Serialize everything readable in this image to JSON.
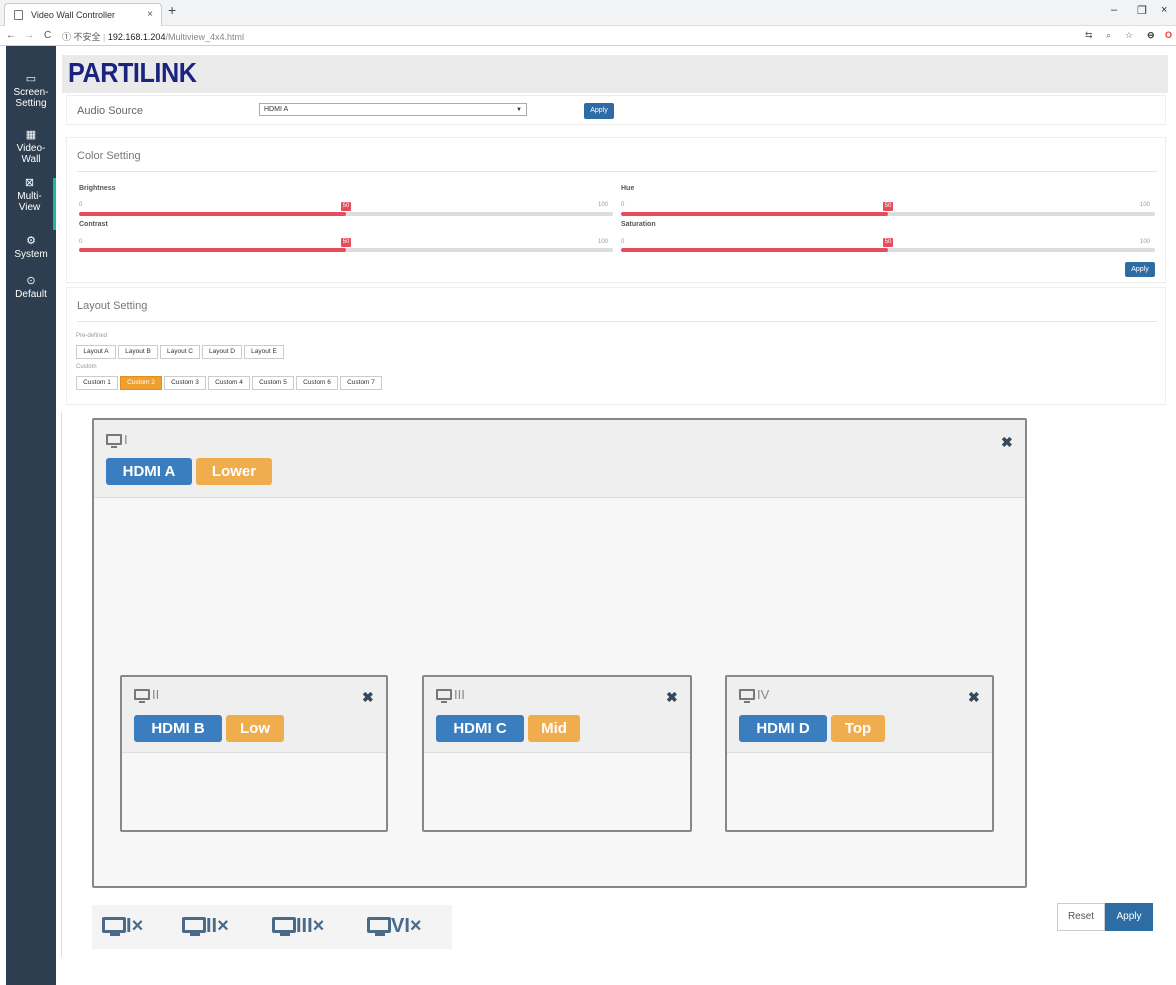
{
  "browser": {
    "tab_title": "Video Wall Controller",
    "tab_close": "×",
    "new_tab": "+",
    "nav_back": "←",
    "nav_forward": "→",
    "reload": "C",
    "security_text": "① 不安全",
    "separator": "|",
    "url_host": "192.168.1.204",
    "url_path": "/Multiview_4x4.html",
    "win_minimize": "–",
    "win_restore": "❐",
    "win_close": "×"
  },
  "sidebar": {
    "items": [
      {
        "icon": "monitor-icon",
        "glyph": "▭",
        "label1": "Screen-",
        "label2": "Setting"
      },
      {
        "icon": "grid-icon",
        "glyph": "▦",
        "label1": "Video-",
        "label2": "Wall"
      },
      {
        "icon": "multiview-icon",
        "glyph": "⊠",
        "label1": "Multi-",
        "label2": "View"
      },
      {
        "icon": "gear-icon",
        "glyph": "⚙",
        "label1": "System",
        "label2": ""
      },
      {
        "icon": "reset-icon",
        "glyph": "⊙",
        "label1": "Default",
        "label2": ""
      }
    ]
  },
  "header": {
    "logo": "PARTILINK"
  },
  "audio": {
    "label": "Audio Source",
    "selected": "HDMI A",
    "apply_label": "Apply"
  },
  "color": {
    "title": "Color Setting",
    "brightness": {
      "label": "Brightness",
      "min": "0",
      "max": "100",
      "value": "50"
    },
    "contrast": {
      "label": "Contrast",
      "min": "0",
      "max": "100",
      "value": "50"
    },
    "hue": {
      "label": "Hue",
      "min": "0",
      "max": "100",
      "value": "50"
    },
    "saturation": {
      "label": "Saturation",
      "min": "0",
      "max": "100",
      "value": "50"
    },
    "apply_label": "Apply"
  },
  "layout": {
    "title": "Layout Setting",
    "predefined_label": "Pre-defined",
    "predefined": [
      "Layout A",
      "Layout B",
      "Layout C",
      "Layout D",
      "Layout E"
    ],
    "custom_label": "Custom",
    "custom": [
      "Custom 1",
      "Custom 2",
      "Custom 3",
      "Custom 4",
      "Custom 5",
      "Custom 6",
      "Custom 7"
    ],
    "active_custom": "Custom 2"
  },
  "windows": [
    {
      "name": "I",
      "source": "HDMI A",
      "layer": "Lower"
    },
    {
      "name": "II",
      "source": "HDMI B",
      "layer": "Low"
    },
    {
      "name": "III",
      "source": "HDMI C",
      "layer": "Mid"
    },
    {
      "name": "IV",
      "source": "HDMI D",
      "layer": "Top"
    }
  ],
  "tray": {
    "items": [
      "I",
      "II",
      "III",
      "VI"
    ],
    "remove_glyph": "×"
  },
  "actions": {
    "reset_label": "Reset",
    "apply_label": "Apply"
  },
  "colors": {
    "sidebar": "#2c3e50",
    "primary": "#2e6da4",
    "accent": "#f0ad4e",
    "slider": "#e74c5c"
  }
}
